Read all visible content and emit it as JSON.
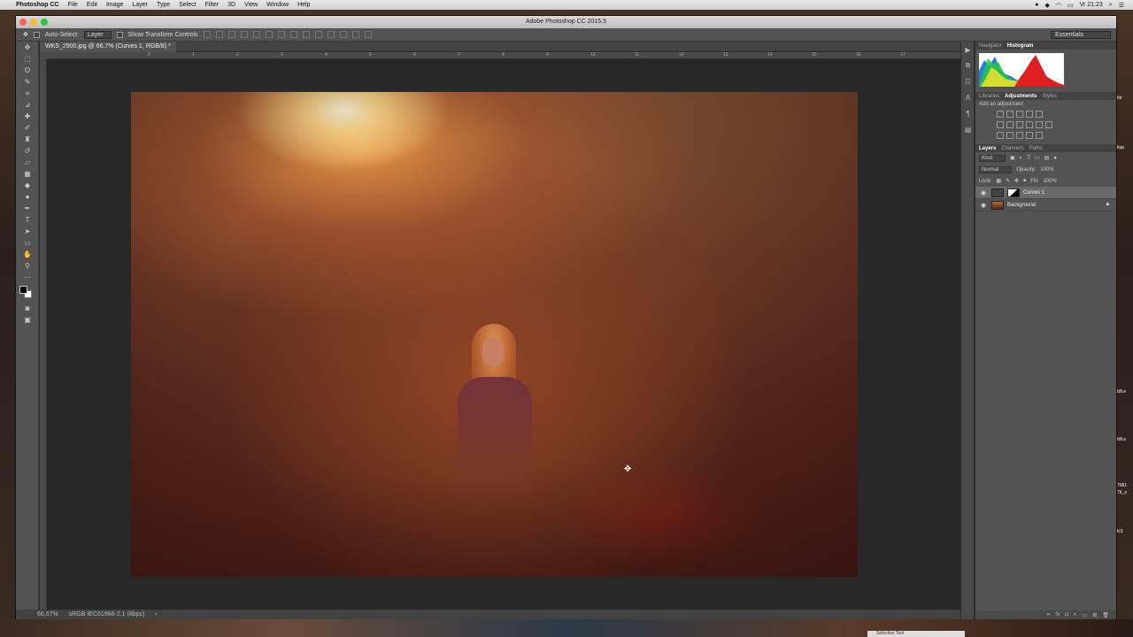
{
  "menubar": {
    "app": "Photoshop CC",
    "items": [
      "File",
      "Edit",
      "Image",
      "Layer",
      "Type",
      "Select",
      "Filter",
      "3D",
      "View",
      "Window",
      "Help"
    ],
    "clock": "Vr 21:23"
  },
  "window": {
    "title": "Adobe Photoshop CC 2015.5"
  },
  "options": {
    "auto_select_label": "Auto-Select:",
    "auto_select_value": "Layer",
    "transform_label": "Show Transform Controls",
    "workspace": "Essentials"
  },
  "document": {
    "tab_title": "WKS_2900.jpg @ 66,7% (Curves 1, RGB/8) *",
    "zoom": "66,67%",
    "profile": "sRGB IEC61966-2.1 (8bpc)"
  },
  "ruler": {
    "h_ticks": [
      "0",
      "1",
      "2",
      "3",
      "4",
      "5",
      "6",
      "7",
      "8",
      "9",
      "10",
      "11",
      "12",
      "13",
      "14",
      "15",
      "16",
      "17"
    ]
  },
  "panels": {
    "top_tabs": [
      "Navigator",
      "Histogram"
    ],
    "mid_tabs": [
      "Libraries",
      "Adjustments",
      "Styles"
    ],
    "add_adjustment": "Add an adjustment",
    "layer_tabs": [
      "Layers",
      "Channels",
      "Paths"
    ],
    "kind": "Kind",
    "blend_mode": "Normal",
    "opacity_label": "Opacity:",
    "opacity_value": "100%",
    "lock_label": "Lock:",
    "fill_label": "Fill:",
    "fill_value": "100%",
    "layers": [
      {
        "name": "Curves 1"
      },
      {
        "name": "Background"
      }
    ]
  },
  "desktop": {
    "side_labels": [
      "for",
      "kup",
      "tW.e",
      "tW.e",
      "7081",
      "76_o",
      "KS"
    ],
    "dock_tooltip": "Selection Tool"
  },
  "colors": {
    "panel_bg": "#535353",
    "canvas_bg": "#282828",
    "selected_layer": "#6a6a6a"
  }
}
